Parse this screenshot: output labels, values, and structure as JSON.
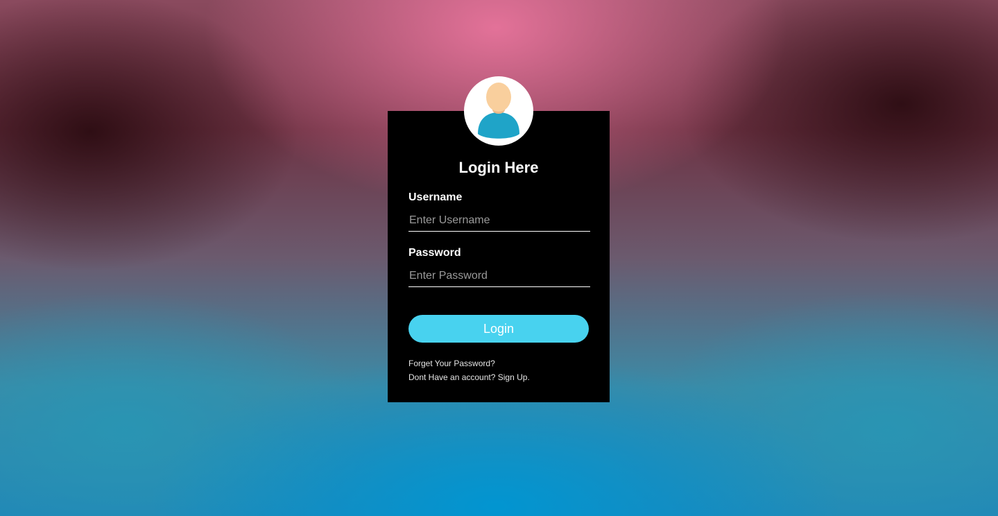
{
  "login": {
    "title": "Login Here",
    "username": {
      "label": "Username",
      "placeholder": "Enter Username",
      "value": ""
    },
    "password": {
      "label": "Password",
      "placeholder": "Enter Password",
      "value": ""
    },
    "submit_label": "Login",
    "forgot_password_link": "Forget Your Password?",
    "signup_link": "Dont Have an account? Sign Up."
  },
  "icons": {
    "avatar": "user-avatar-icon"
  },
  "colors": {
    "panel_background": "#000000",
    "button": "#48d2ef",
    "avatar_skin": "#f9cf9d",
    "avatar_shirt": "#1fa4c8",
    "avatar_circle": "#ffffff"
  }
}
